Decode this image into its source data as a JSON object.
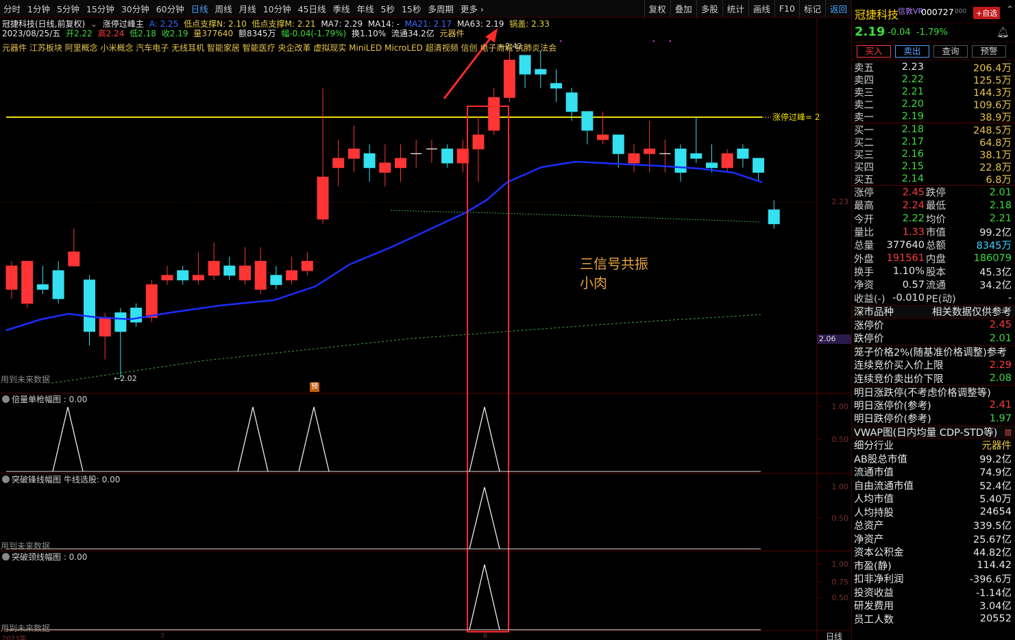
{
  "toolbar": {
    "periods": [
      "分时",
      "1分钟",
      "5分钟",
      "15分钟",
      "30分钟",
      "60分钟",
      "日线",
      "周线",
      "月线",
      "10分钟",
      "45日线",
      "季线",
      "年线",
      "5秒",
      "15秒",
      "多周期",
      "更多 ›"
    ],
    "active_period": "日线",
    "right_items": [
      "复权",
      "叠加",
      "多股",
      "统计",
      "画线",
      "F10",
      "标记",
      "返回"
    ]
  },
  "chart": {
    "title_line": {
      "name": "冠捷科技(日线,前复权)",
      "indicator": "涨停过峰主",
      "a": "A: 2.25",
      "n_support": "低点支撑N: 2.10",
      "m_support": "低点支撑M: 2.21",
      "ma7": "MA7: 2.29",
      "ma14": "MA14: -",
      "ma21": "MA21: 2.17",
      "ma63": "MA63: 2.19",
      "pot": "锅盖: 2.33"
    },
    "ohlc_line": {
      "date": "2023/08/25/五",
      "open": "开2.22",
      "high": "高2.24",
      "low": "低2.18",
      "close": "收2.19",
      "volume": "量377640",
      "amount": "额8345万",
      "change": "幅-0.04(-1.79%)",
      "turnover": "换1.10%",
      "float": "流通34.2亿",
      "sector": "元器件"
    },
    "concepts": "元器件 江苏板块 阿里概念 小米概念 汽车电子 无线耳机 智能家居 智能医疗 央企改革 虚拟现实 MiniLED MicroLED 超清视频 信创 电子商城 抗肺炎法会",
    "peak_label": "2.42",
    "low_label": "2.02",
    "yellow_line_label": "涨停过峰= 2",
    "price_axis": [
      "2.23",
      "2.06"
    ],
    "future_label": "用到未来数据",
    "pre_badge": "预",
    "annotation_line1": "三信号共振",
    "annotation_line2": "小肉",
    "panel1_title": "倍量单枪幅图 : 0.00",
    "panel2_title": "突破锋线幅图 牛线选股: 0.00",
    "panel3_title": "突破颈线幅图 : 0.00",
    "panel_axis1": [
      "1.00",
      "0.50"
    ],
    "panel_axis2": [
      "1.00",
      "0.50"
    ],
    "panel_axis3": [
      "1.00",
      "0.75",
      "0.50"
    ],
    "bottom_year": "2023年",
    "bottom_m7": "7",
    "bottom_m8": "8",
    "bottom_right": "日线"
  },
  "candles": [
    {
      "o": 2.05,
      "c": 2.1,
      "h": 2.11,
      "l": 2.03
    },
    {
      "o": 2.02,
      "c": 2.11,
      "h": 2.11,
      "l": 2.01
    },
    {
      "o": 2.06,
      "c": 2.05,
      "h": 2.1,
      "l": 2.04
    },
    {
      "o": 2.09,
      "c": 2.03,
      "h": 2.11,
      "l": 2.02
    },
    {
      "o": 2.1,
      "c": 2.13,
      "h": 2.18,
      "l": 2.1
    },
    {
      "o": 2.07,
      "c": 1.96,
      "h": 2.08,
      "l": 1.93
    },
    {
      "o": 1.95,
      "c": 1.99,
      "h": 2.0,
      "l": 1.9
    },
    {
      "o": 2.0,
      "c": 1.96,
      "h": 2.01,
      "l": 1.86
    },
    {
      "o": 2.01,
      "c": 1.98,
      "h": 2.02,
      "l": 1.97
    },
    {
      "o": 1.99,
      "c": 2.06,
      "h": 2.07,
      "l": 1.98
    },
    {
      "o": 2.07,
      "c": 2.08,
      "h": 2.1,
      "l": 2.06
    },
    {
      "o": 2.09,
      "c": 2.07,
      "h": 2.1,
      "l": 2.06
    },
    {
      "o": 2.07,
      "c": 2.08,
      "h": 2.13,
      "l": 2.06
    },
    {
      "o": 2.08,
      "c": 2.11,
      "h": 2.15,
      "l": 2.07
    },
    {
      "o": 2.1,
      "c": 2.08,
      "h": 2.12,
      "l": 2.07
    },
    {
      "o": 2.07,
      "c": 2.1,
      "h": 2.14,
      "l": 2.06
    },
    {
      "o": 2.05,
      "c": 2.11,
      "h": 2.14,
      "l": 2.04
    },
    {
      "o": 2.08,
      "c": 2.06,
      "h": 2.1,
      "l": 2.05
    },
    {
      "o": 2.07,
      "c": 2.09,
      "h": 2.12,
      "l": 2.06
    },
    {
      "o": 2.09,
      "c": 2.11,
      "h": 2.13,
      "l": 2.08
    },
    {
      "o": 2.2,
      "c": 2.29,
      "h": 2.48,
      "l": 2.19
    },
    {
      "o": 2.31,
      "c": 2.33,
      "h": 2.37,
      "l": 2.27
    },
    {
      "o": 2.33,
      "c": 2.35,
      "h": 2.4,
      "l": 2.3
    },
    {
      "o": 2.34,
      "c": 2.31,
      "h": 2.36,
      "l": 2.28
    },
    {
      "o": 2.3,
      "c": 2.32,
      "h": 2.36,
      "l": 2.27
    },
    {
      "o": 2.31,
      "c": 2.33,
      "h": 2.36,
      "l": 2.28
    },
    {
      "o": 2.34,
      "c": 2.34,
      "h": 2.37,
      "l": 2.31
    },
    {
      "o": 2.35,
      "c": 2.35,
      "h": 2.37,
      "l": 2.32
    },
    {
      "o": 2.35,
      "c": 2.32,
      "h": 2.36,
      "l": 2.31
    },
    {
      "o": 2.32,
      "c": 2.35,
      "h": 2.37,
      "l": 2.3
    },
    {
      "o": 2.35,
      "c": 2.38,
      "h": 2.42,
      "l": 2.28
    },
    {
      "o": 2.39,
      "c": 2.46,
      "h": 2.48,
      "l": 2.38
    },
    {
      "o": 2.46,
      "c": 2.54,
      "h": 2.56,
      "l": 2.45
    },
    {
      "o": 2.55,
      "c": 2.51,
      "h": 2.54,
      "l": 2.48
    },
    {
      "o": 2.52,
      "c": 2.51,
      "h": 2.56,
      "l": 2.48
    },
    {
      "o": 2.49,
      "c": 2.48,
      "h": 2.52,
      "l": 2.45
    },
    {
      "o": 2.47,
      "c": 2.43,
      "h": 2.48,
      "l": 2.41
    },
    {
      "o": 2.43,
      "c": 2.39,
      "h": 2.43,
      "l": 2.36
    },
    {
      "o": 2.37,
      "c": 2.38,
      "h": 2.43,
      "l": 2.36
    },
    {
      "o": 2.38,
      "c": 2.34,
      "h": 2.38,
      "l": 2.31
    },
    {
      "o": 2.32,
      "c": 2.34,
      "h": 2.36,
      "l": 2.3
    },
    {
      "o": 2.34,
      "c": 2.35,
      "h": 2.41,
      "l": 2.3
    },
    {
      "o": 2.34,
      "c": 2.34,
      "h": 2.37,
      "l": 2.3
    },
    {
      "o": 2.35,
      "c": 2.3,
      "h": 2.36,
      "l": 2.28
    },
    {
      "o": 2.34,
      "c": 2.33,
      "h": 2.42,
      "l": 2.32
    },
    {
      "o": 2.32,
      "c": 2.31,
      "h": 2.36,
      "l": 2.3
    },
    {
      "o": 2.31,
      "c": 2.34,
      "h": 2.35,
      "l": 2.3
    },
    {
      "o": 2.35,
      "c": 2.33,
      "h": 2.36,
      "l": 2.31
    },
    {
      "o": 2.33,
      "c": 2.3,
      "h": 2.33,
      "l": 2.28
    },
    {
      "o": 2.22,
      "c": 2.19,
      "h": 2.24,
      "l": 2.18
    }
  ],
  "side": {
    "name": "冠捷科技",
    "sub": "信敦VR",
    "code": "000727",
    "code_suffix": "000",
    "add_label": "+自选",
    "price": "2.19",
    "change": "-0.04",
    "pct": "-1.79%",
    "buttons": [
      "买入",
      "卖出",
      "查询",
      "预警"
    ],
    "asks": [
      {
        "label": "卖五",
        "price": "2.23",
        "vol": "206.4万"
      },
      {
        "label": "卖四",
        "price": "2.22",
        "vol": "125.5万"
      },
      {
        "label": "卖三",
        "price": "2.21",
        "vol": "144.3万"
      },
      {
        "label": "卖二",
        "price": "2.20",
        "vol": "109.6万"
      },
      {
        "label": "卖一",
        "price": "2.19",
        "vol": "38.9万"
      }
    ],
    "bids": [
      {
        "label": "买一",
        "price": "2.18",
        "vol": "248.5万"
      },
      {
        "label": "买二",
        "price": "2.17",
        "vol": "64.8万"
      },
      {
        "label": "买三",
        "price": "2.16",
        "vol": "38.1万"
      },
      {
        "label": "买四",
        "price": "2.15",
        "vol": "22.8万"
      },
      {
        "label": "买五",
        "price": "2.14",
        "vol": "6.8万"
      }
    ],
    "stats": [
      {
        "a": "涨停",
        "b": "2.45",
        "bc": "red",
        "c": "跌停",
        "d": "2.01",
        "dc": "green"
      },
      {
        "a": "最高",
        "b": "2.24",
        "bc": "red",
        "c": "最低",
        "d": "2.18",
        "dc": "green"
      },
      {
        "a": "今开",
        "b": "2.22",
        "bc": "green",
        "c": "均价",
        "d": "2.21",
        "dc": "green"
      },
      {
        "a": "量比",
        "b": "1.33",
        "bc": "red",
        "c": "市值",
        "d": "99.2亿",
        "dc": "white"
      },
      {
        "a": "总量",
        "b": "377640",
        "bc": "white",
        "c": "总额",
        "d": "8345万",
        "dc": "cyan"
      },
      {
        "a": "外盘",
        "b": "191561",
        "bc": "red",
        "c": "内盘",
        "d": "186079",
        "dc": "green"
      },
      {
        "a": "换手",
        "b": "1.10%",
        "bc": "white",
        "c": "股本",
        "d": "45.3亿",
        "dc": "white"
      },
      {
        "a": "净资",
        "b": "0.57",
        "bc": "white",
        "c": "流通",
        "d": "34.2亿",
        "dc": "white"
      },
      {
        "a": "收益(-)",
        "b": "-0.010",
        "bc": "white",
        "c": "PE(动)",
        "d": "-",
        "dc": "white"
      }
    ],
    "market_head": "深市品种",
    "market_note": "相关数据仅供参考",
    "limits": [
      {
        "k": "涨停价",
        "v": "2.45",
        "c": "red"
      },
      {
        "k": "跌停价",
        "v": "2.01",
        "c": "green"
      }
    ],
    "cage_line": "笼子价格2%(随基准价格调整)参考",
    "auction": [
      {
        "k": "连续竞价买入价上限",
        "v": "2.29",
        "c": "red"
      },
      {
        "k": "连续竞价卖出价下限",
        "v": "2.08",
        "c": "green"
      }
    ],
    "tomorrow_head": "明日涨跌停(不考虑价格调整等)",
    "tomorrow": [
      {
        "k": "明日涨停价(参考)",
        "v": "2.41",
        "c": "red"
      },
      {
        "k": "明日跌停价(参考)",
        "v": "1.97",
        "c": "green"
      }
    ],
    "vwap": "VWAP图(日内均量 CDP-STD等)",
    "fundamentals": [
      {
        "k": "细分行业",
        "v": "元器件",
        "c": "yellow"
      },
      {
        "k": "AB股总市值",
        "v": "99.2亿",
        "c": "white"
      },
      {
        "k": "流通市值",
        "v": "74.9亿",
        "c": "white"
      },
      {
        "k": "自由流通市值",
        "v": "52.4亿",
        "c": "white"
      },
      {
        "k": "人均市值",
        "v": "5.40万",
        "c": "white"
      },
      {
        "k": "人均持股",
        "v": "24654",
        "c": "white"
      },
      {
        "k": "总资产",
        "v": "339.5亿",
        "c": "white"
      },
      {
        "k": "净资产",
        "v": "25.67亿",
        "c": "white"
      },
      {
        "k": "资本公积金",
        "v": "44.82亿",
        "c": "white"
      },
      {
        "k": "市盈(静)",
        "v": "114.42",
        "c": "white"
      },
      {
        "k": "扣非净利润",
        "v": "-396.6万",
        "c": "white"
      },
      {
        "k": "投资收益",
        "v": "-1.14亿",
        "c": "white"
      },
      {
        "k": "研发费用",
        "v": "3.04亿",
        "c": "white"
      },
      {
        "k": "员工人数",
        "v": "20552",
        "c": "white"
      }
    ]
  }
}
